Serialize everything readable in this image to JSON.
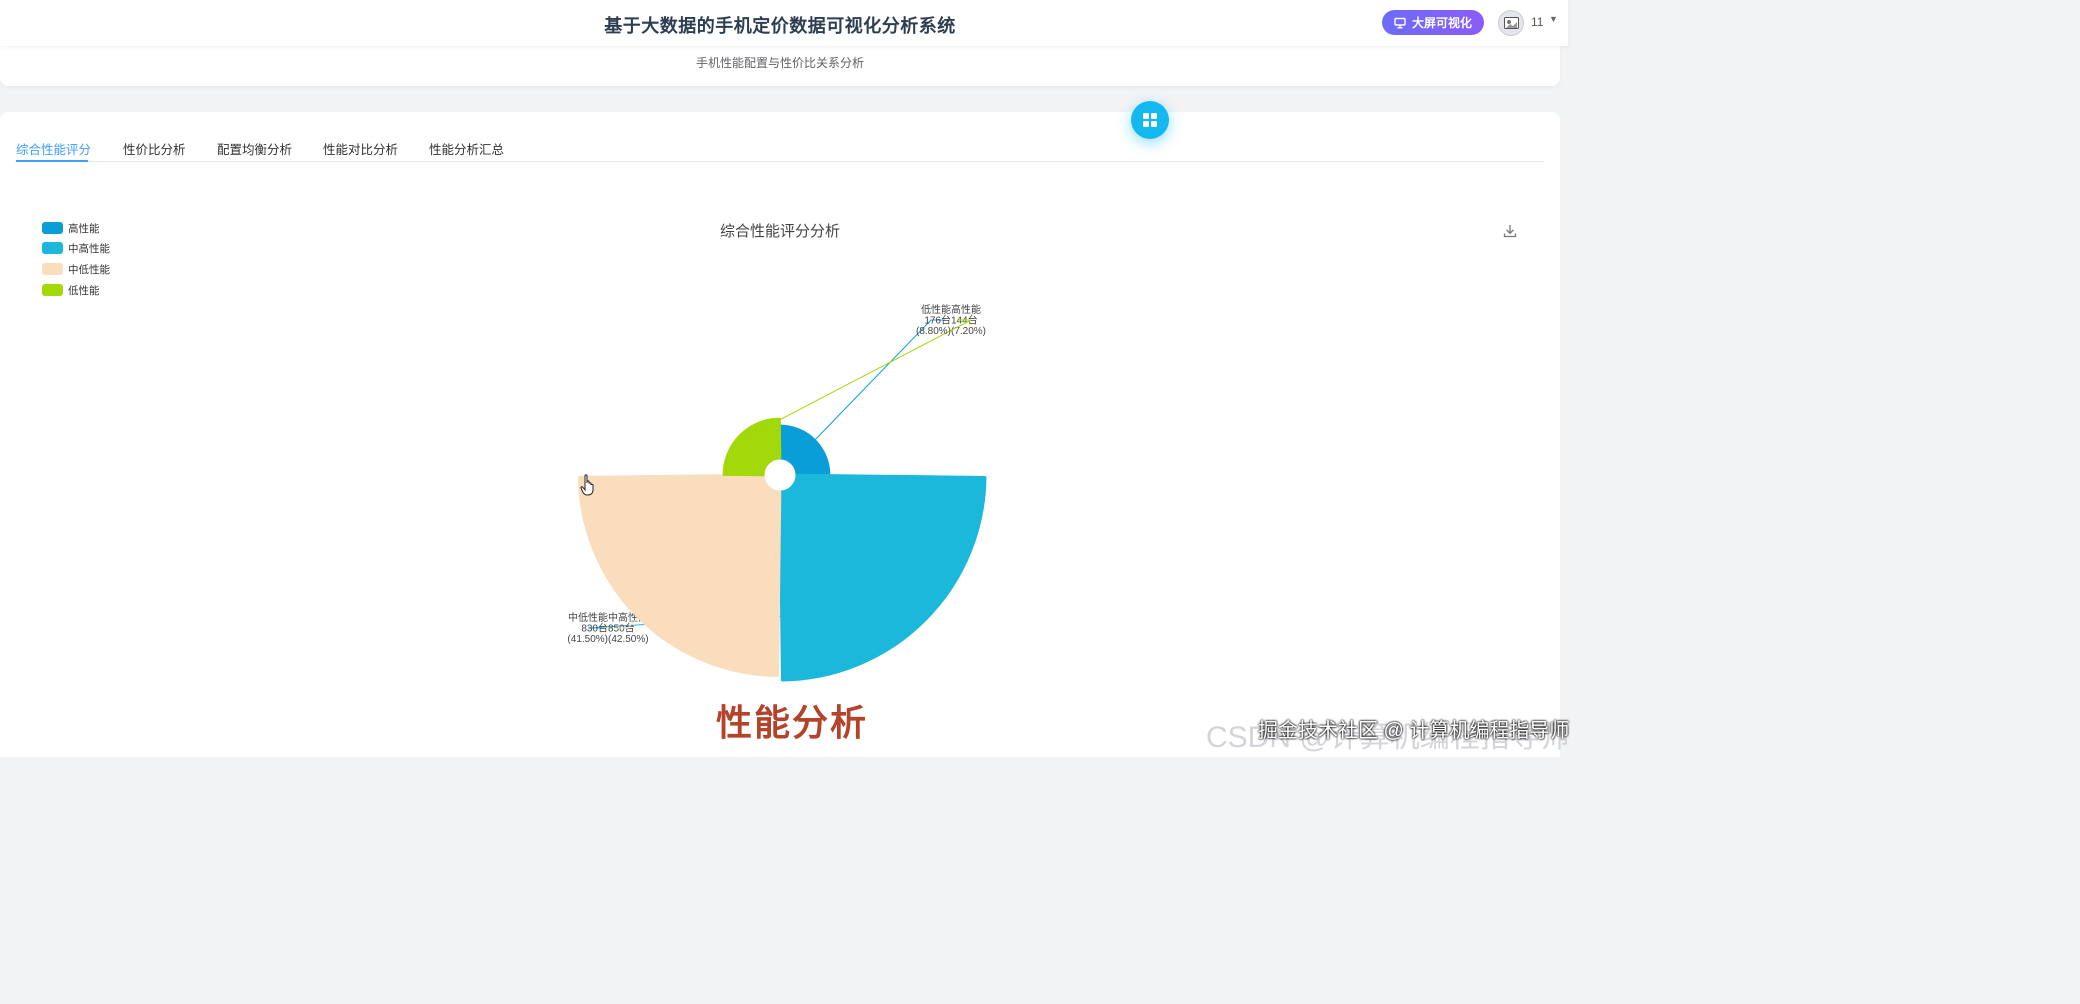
{
  "header": {
    "app_title": "基于大数据的手机定价数据可视化分析系统",
    "bigscreen_label": "大屏可视化",
    "user_name": "11",
    "subtitle": "手机性能配置与性价比关系分析"
  },
  "tabs": [
    {
      "label": "综合性能评分",
      "active": true
    },
    {
      "label": "性价比分析",
      "active": false
    },
    {
      "label": "配置均衡分析",
      "active": false
    },
    {
      "label": "性能对比分析",
      "active": false
    },
    {
      "label": "性能分析汇总",
      "active": false
    }
  ],
  "chart_data": {
    "type": "pie",
    "subtype": "rose",
    "title": "综合性能评分分析",
    "legend_position": "top-left",
    "series": [
      {
        "name": "高性能",
        "value": 144,
        "unit": "台",
        "percent": "7.20%",
        "color": "#0a9ed9"
      },
      {
        "name": "中高性能",
        "value": 850,
        "unit": "台",
        "percent": "42.50%",
        "color": "#1bb8dc"
      },
      {
        "name": "中低性能",
        "value": 830,
        "unit": "台",
        "percent": "41.50%",
        "color": "#f9ddbd"
      },
      {
        "name": "低性能",
        "value": 176,
        "unit": "台",
        "percent": "8.80%",
        "color": "#a3d80b"
      }
    ]
  },
  "caption": "性能分析",
  "watermark": "掘金技术社区 @ 计算机编程指导师",
  "watermark_faint": "CSDN @计算机编程指导师"
}
